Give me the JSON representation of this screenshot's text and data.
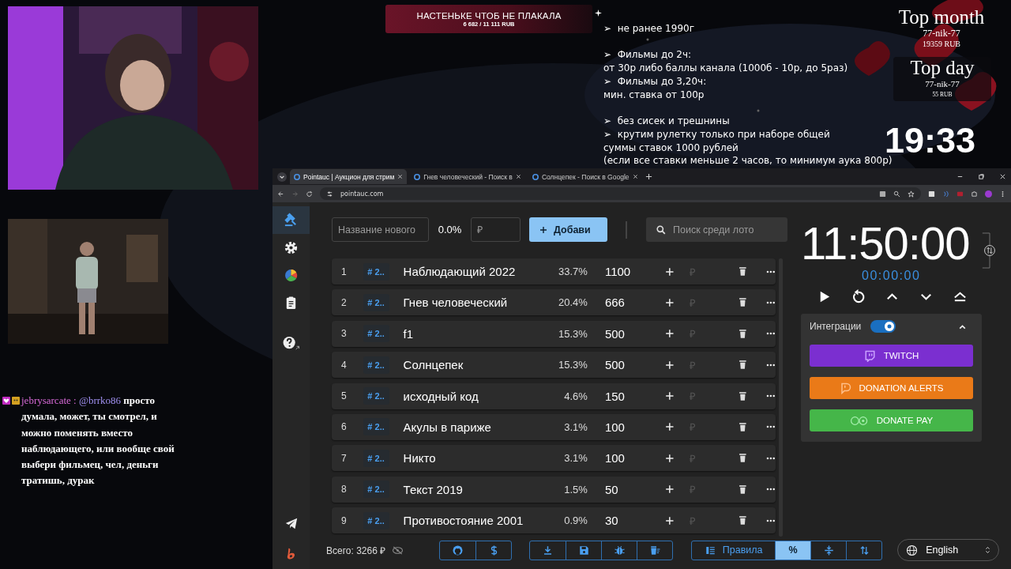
{
  "stream": {
    "goal": {
      "title": "НАСТЕНЬКЕ ЧТОБ НЕ ПЛАКАЛА",
      "amount": "6 682 / 11 111 RUB"
    },
    "rules": [
      [
        "➢  не ранее 1990г"
      ],
      [
        "➢  Фильмы до 2ч:",
        "от 30р либо баллы канала (1000б - 10р, до 5раз)",
        "➢  Фильмы до 3,20ч:",
        "мин. ставка от 100р"
      ],
      [
        "➢  без сисек и трешнины",
        "➢  крутим рулетку только при наборе общей",
        "суммы ставок 1000 рублей",
        "(если все ставки меньше 2 часов, то минимум аука 800р)"
      ]
    ],
    "top_month": {
      "title": "Top month",
      "name": "77-nik-77",
      "amount": "19359 RUB"
    },
    "top_day": {
      "title": "Top day",
      "name": "77-nik-77",
      "amount": "55 RUB"
    },
    "clock": "19:33",
    "chat": {
      "user": "jebrysarcate :",
      "mention": "@brrko86",
      "message": "просто думала, может, ты смотрел, и можно поменять вместо наблюдающего, или вообще свой выбери фильмец, чел, деньги тратишь, дурак"
    }
  },
  "browser": {
    "tabs": [
      {
        "title": "Pointauc | Аукцион для стрим",
        "selected": true
      },
      {
        "title": "Гнев человеческий - Поиск в",
        "selected": false
      },
      {
        "title": "Солнцепек - Поиск в Google",
        "selected": false
      }
    ],
    "url": "pointauc.com"
  },
  "sidebar": {
    "items": [
      {
        "kind": "auction",
        "selected": true
      },
      {
        "kind": "settings",
        "selected": false
      },
      {
        "kind": "stats",
        "selected": false
      },
      {
        "kind": "history",
        "selected": false
      },
      {
        "kind": "help",
        "selected": false
      }
    ]
  },
  "new_lot": {
    "name_placeholder": "Название нового",
    "percent": "0.0%",
    "amount_placeholder": "₽",
    "add_button": "Добави"
  },
  "search": {
    "placeholder": "Поиск среди лото"
  },
  "lots": [
    {
      "index": "1",
      "tag": "# 2..",
      "name": "Наблюдающий 2022",
      "percent": "33.7%",
      "amount": "1100",
      "currency": "₽"
    },
    {
      "index": "2",
      "tag": "# 2..",
      "name": "Гнев человеческий",
      "percent": "20.4%",
      "amount": "666",
      "currency": "₽"
    },
    {
      "index": "3",
      "tag": "# 2..",
      "name": "f1",
      "percent": "15.3%",
      "amount": "500",
      "currency": "₽"
    },
    {
      "index": "4",
      "tag": "# 2..",
      "name": "Солнцепек",
      "percent": "15.3%",
      "amount": "500",
      "currency": "₽"
    },
    {
      "index": "5",
      "tag": "# 2..",
      "name": "исходный код",
      "percent": "4.6%",
      "amount": "150",
      "currency": "₽"
    },
    {
      "index": "6",
      "tag": "# 2..",
      "name": "Акулы в париже",
      "percent": "3.1%",
      "amount": "100",
      "currency": "₽"
    },
    {
      "index": "7",
      "tag": "# 2..",
      "name": "Никто",
      "percent": "3.1%",
      "amount": "100",
      "currency": "₽"
    },
    {
      "index": "8",
      "tag": "# 2..",
      "name": "Текст 2019",
      "percent": "1.5%",
      "amount": "50",
      "currency": "₽"
    },
    {
      "index": "9",
      "tag": "# 2..",
      "name": "Противостояние 2001",
      "percent": "0.9%",
      "amount": "30",
      "currency": "₽"
    }
  ],
  "timer": {
    "time": "11:50:00",
    "elapsed": "00:00:00"
  },
  "integrations": {
    "label": "Интеграции",
    "enabled": true,
    "expanded": true,
    "buttons": [
      {
        "kind": "twitch",
        "label": "TWITCH"
      },
      {
        "kind": "donation_alerts",
        "label": "DONATION ALERTS"
      },
      {
        "kind": "donate_pay",
        "label": "DONATE PAY"
      }
    ]
  },
  "footer": {
    "total": "Всего: 3266 ₽",
    "view_buttons": [
      {
        "kind": "rules",
        "label": "Правила",
        "selected": false
      },
      {
        "kind": "percent",
        "label": "%",
        "selected": true
      },
      {
        "kind": "compact",
        "selected": false
      },
      {
        "kind": "sort",
        "selected": false
      }
    ],
    "language": "English"
  }
}
